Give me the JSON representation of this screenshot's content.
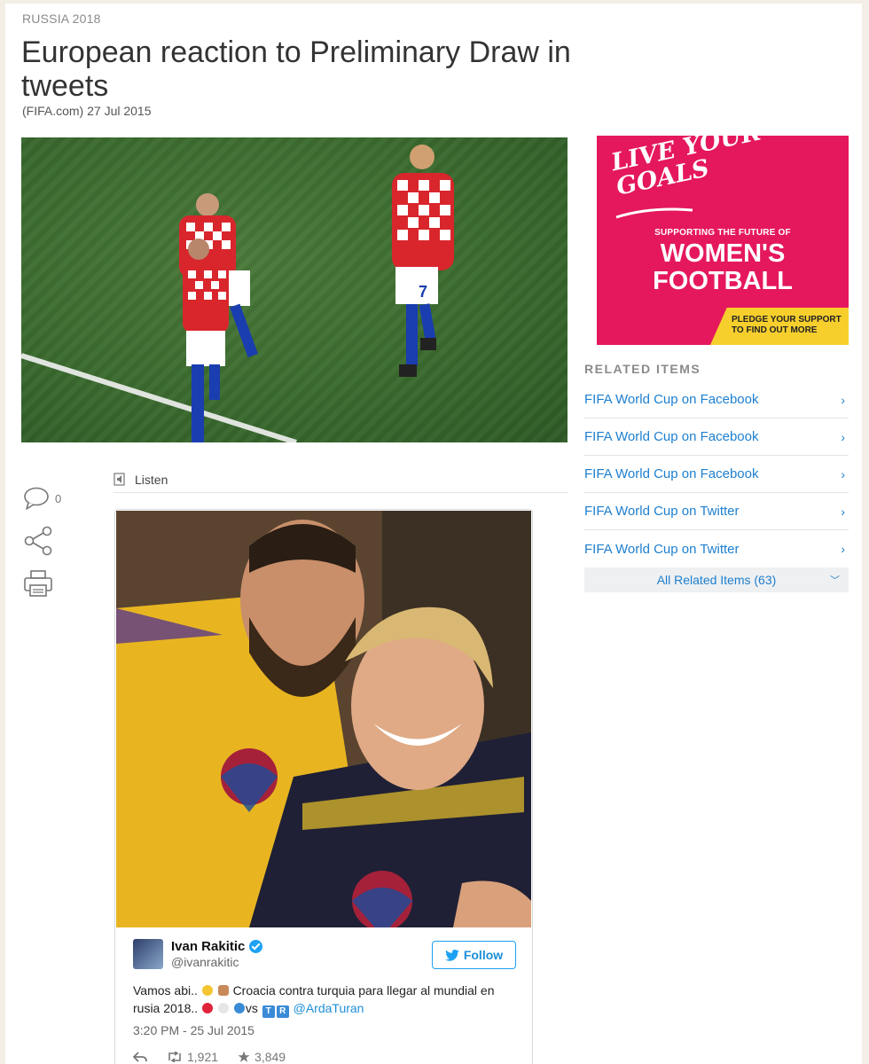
{
  "article": {
    "section": "RUSSIA 2018",
    "headline": "European reaction to Preliminary Draw in tweets",
    "byline": "(FIFA.com) 27 Jul 2015"
  },
  "tools": {
    "comment_count": "0"
  },
  "listen": {
    "label": "Listen"
  },
  "tweet": {
    "author_name": "Ivan Rakitic",
    "author_handle": "@ivanrakitic",
    "follow_label": "Follow",
    "text_part1": "Vamos abi..",
    "text_part2": "Croacia contra turquia para llegar al mundial en rusia 2018..",
    "text_vs": "vs",
    "flag_letters": [
      "T",
      "R"
    ],
    "mention": "@ArdaTuran",
    "time": "3:20 PM - 25 Jul 2015",
    "retweets": "1,921",
    "likes": "3,849"
  },
  "ad": {
    "tagline": "LIVE YOUR GOALS",
    "subtitle": "SUPPORTING THE FUTURE OF",
    "title": "WOMEN'S FOOTBALL",
    "cta": "PLEDGE YOUR SUPPORT TO FIND OUT MORE",
    "background_color": "#e5185d",
    "cta_color": "#f7cf2d"
  },
  "related": {
    "title": "RELATED ITEMS",
    "items": [
      {
        "label": "FIFA World Cup on Facebook"
      },
      {
        "label": "FIFA World Cup on Facebook"
      },
      {
        "label": "FIFA World Cup on Facebook"
      },
      {
        "label": "FIFA World Cup on Twitter"
      },
      {
        "label": "FIFA World Cup on Twitter"
      }
    ],
    "all_label": "All Related Items (63)"
  },
  "colors": {
    "link": "#1d7fcf",
    "twitter": "#1da1f2"
  }
}
